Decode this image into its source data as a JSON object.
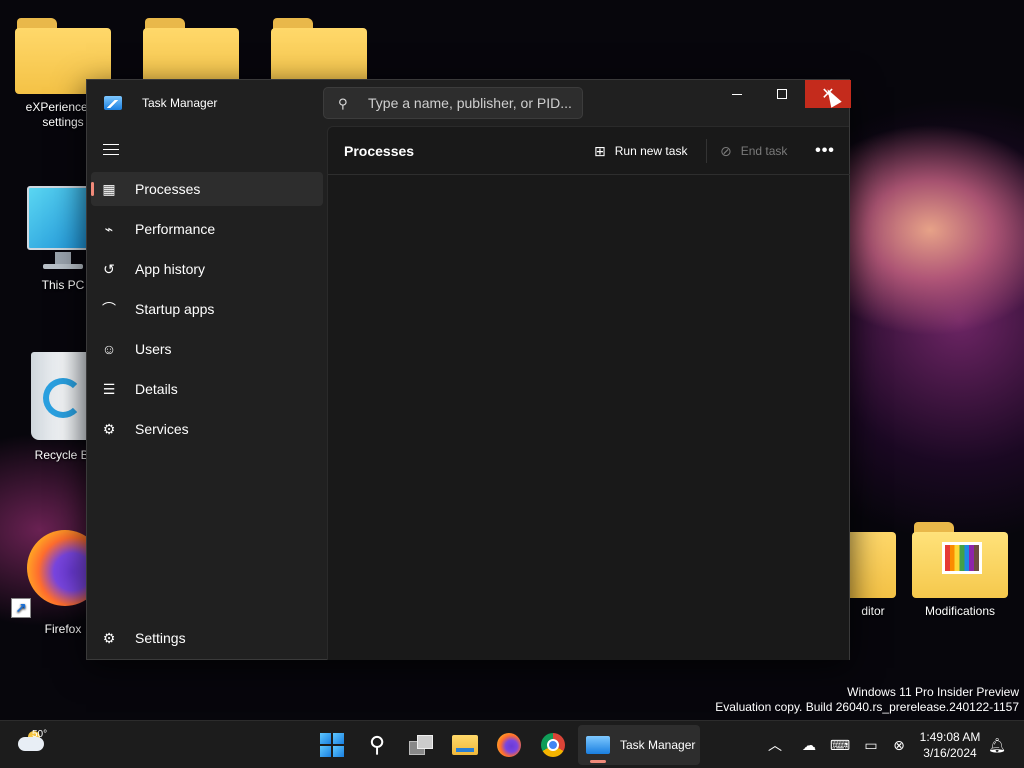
{
  "desktop": {
    "icons": [
      {
        "label": "eXPerience-N settings"
      },
      {
        "label": ""
      },
      {
        "label": ""
      },
      {
        "label": "This PC"
      },
      {
        "label": "Recycle Bi"
      },
      {
        "label": "Firefox"
      },
      {
        "label": "ditor"
      },
      {
        "label": "Modifications"
      }
    ]
  },
  "window": {
    "title": "Task Manager",
    "search": {
      "placeholder": "Type a name, publisher, or PID..."
    },
    "controls": {
      "minimize": "minimize",
      "maximize": "maximize",
      "close": "✕"
    }
  },
  "sidebar": {
    "items": [
      {
        "label": "Processes",
        "icon": "processes-icon",
        "active": true
      },
      {
        "label": "Performance",
        "icon": "performance-icon"
      },
      {
        "label": "App history",
        "icon": "history-icon"
      },
      {
        "label": "Startup apps",
        "icon": "startup-icon"
      },
      {
        "label": "Users",
        "icon": "users-icon"
      },
      {
        "label": "Details",
        "icon": "details-icon"
      },
      {
        "label": "Services",
        "icon": "services-icon"
      }
    ],
    "settings": {
      "label": "Settings",
      "icon": "gear-icon"
    }
  },
  "main": {
    "title": "Processes",
    "run_new_task": "Run new task",
    "end_task": "End task",
    "more": "•••"
  },
  "watermark": {
    "line1": "Windows 11 Pro Insider Preview",
    "line2": "Evaluation copy. Build 26040.rs_prerelease.240122-1157"
  },
  "taskbar": {
    "weather_temp": "50°",
    "task_manager_label": "Task Manager",
    "time": "1:49:08 AM",
    "date": "3/16/2024"
  },
  "colors": {
    "accent": "#f08a7a",
    "close_button": "#c42b1c",
    "window_bg": "#202020",
    "content_bg": "#191919"
  }
}
